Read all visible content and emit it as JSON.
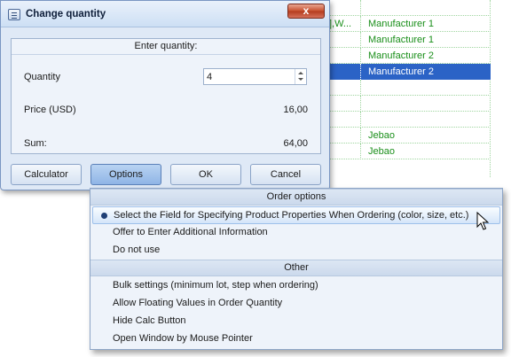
{
  "background_table": {
    "rows": [
      {
        "col1": "",
        "col2": ""
      },
      {
        "col1": "],W...",
        "col2": "Manufacturer 1"
      },
      {
        "col1": "",
        "col2": "Manufacturer 1"
      },
      {
        "col1": "",
        "col2": "Manufacturer 2"
      },
      {
        "col1": "",
        "col2": "Manufacturer 2"
      },
      {
        "col1": "",
        "col2": ""
      },
      {
        "col1": "",
        "col2": ""
      },
      {
        "col1": "",
        "col2": ""
      },
      {
        "col1": "",
        "col2": "Jebao"
      },
      {
        "col1": "",
        "col2": "Jebao"
      }
    ],
    "selected_row": 4
  },
  "dialog": {
    "title": "Change quantity",
    "close_label": "x",
    "panel_header": "Enter quantity:",
    "quantity_label": "Quantity",
    "quantity_value": "4",
    "price_label": "Price (USD)",
    "price_value": "16,00",
    "sum_label": "Sum:",
    "sum_value": "64,00",
    "buttons": {
      "calculator": "Calculator",
      "options": "Options",
      "ok": "OK",
      "cancel": "Cancel"
    }
  },
  "menu": {
    "section1_header": "Order options",
    "section1_items": [
      "Select the Field for Specifying Product Properties When Ordering (color, size, etc.)",
      "Offer to Enter Additional Information",
      "Do not use"
    ],
    "section2_header": "Other",
    "section2_items": [
      "Bulk settings (minimum lot, step when ordering)",
      "Allow Floating Values in Order Quantity",
      "Hide Calc Button",
      "Open Window by Mouse Pointer"
    ]
  },
  "colors": {
    "grid_text": "#1a8f1a",
    "selection": "#2b63c6",
    "dialog_bg": "#dfe9f6",
    "close_button": "#c8502f"
  }
}
